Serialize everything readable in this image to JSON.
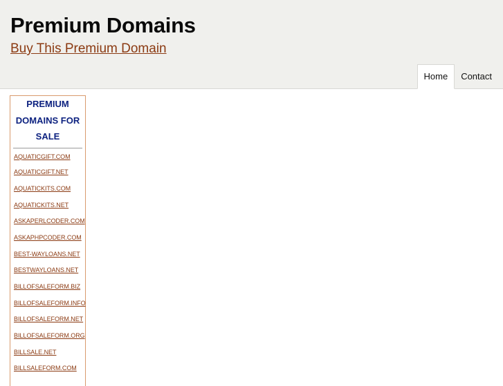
{
  "header": {
    "title": "Premium Domains",
    "tagline": "Buy This Premium Domain"
  },
  "nav": {
    "items": [
      {
        "label": "Home",
        "active": true
      },
      {
        "label": "Contact",
        "active": false
      }
    ]
  },
  "sidebar": {
    "title": "PREMIUM DOMAINS FOR SALE",
    "domains": [
      "AQUATICGIFT.COM",
      "AQUATICGIFT.NET",
      "AQUATICKITS.COM",
      "AQUATICKITS.NET",
      "ASKAPERLCODER.COM",
      "ASKAPHPCODER.COM",
      "BEST-WAYLOANS.NET",
      "BESTWAYLOANS.NET",
      "BILLOFSALEFORM.BIZ",
      "BILLOFSALEFORM.INFO",
      "BILLOFSALEFORM.NET",
      "BILLOFSALEFORM.ORG",
      "BILLSALE.NET",
      "BILLSALEFORM.COM"
    ]
  },
  "colors": {
    "header_bg": "#f0f0ed",
    "link": "#8b3a12",
    "sidebar_title": "#0d2280",
    "sidebar_border": "#d99a6c"
  }
}
